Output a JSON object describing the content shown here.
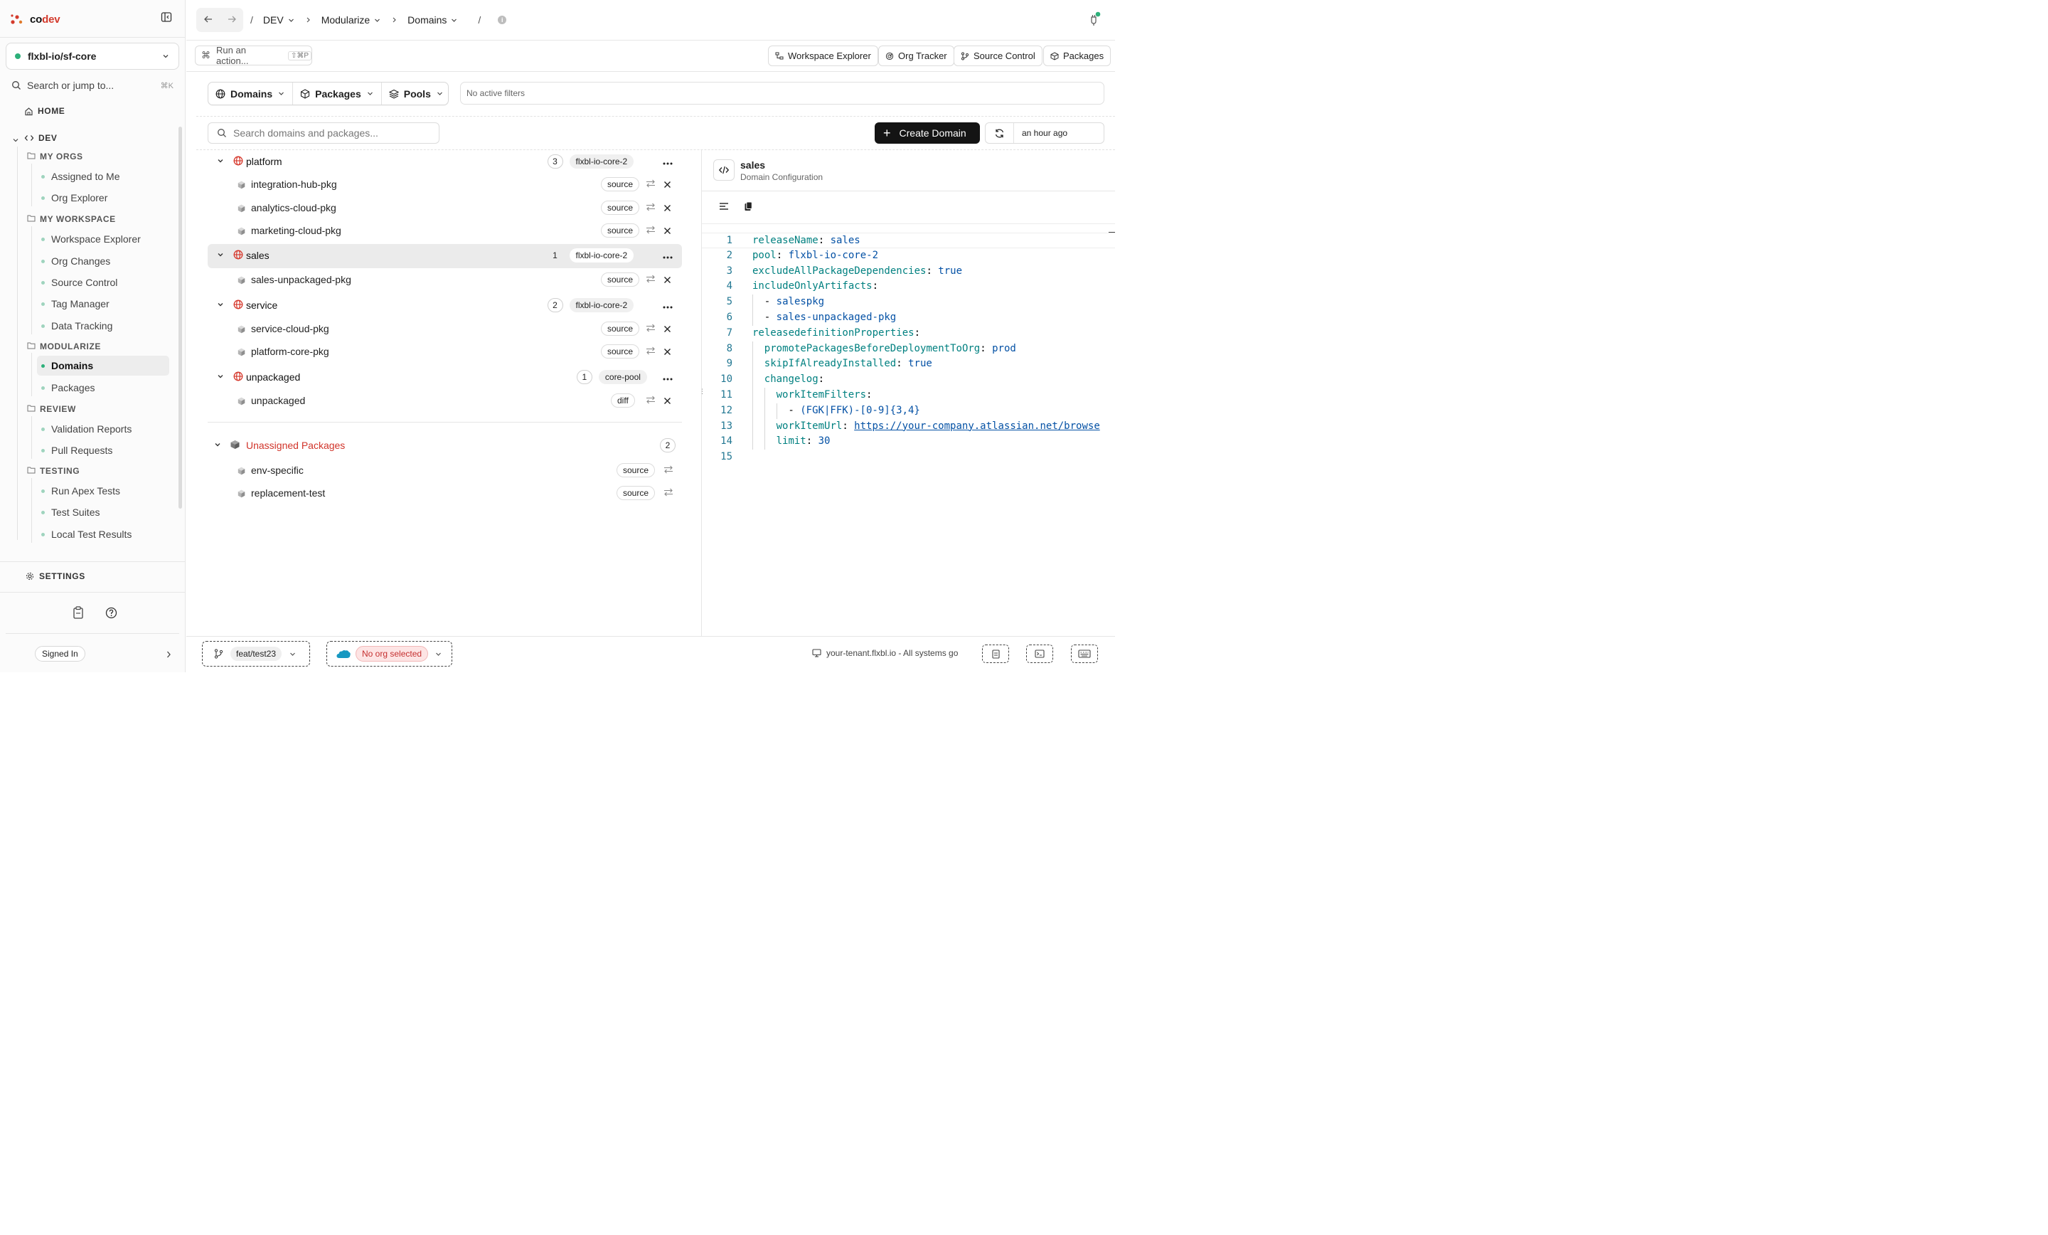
{
  "brand": {
    "name_a": "co",
    "name_b": "dev",
    "accent": "#d33a2c"
  },
  "sidebar": {
    "workspace": "flxbl-io/sf-core",
    "search_placeholder": "Search or jump to...",
    "search_kbd": "⌘K",
    "home": "HOME",
    "root": "DEV",
    "sections": [
      {
        "label": "MY ORGS",
        "items": [
          "Assigned to Me",
          "Org Explorer"
        ]
      },
      {
        "label": "MY WORKSPACE",
        "items": [
          "Workspace Explorer",
          "Org Changes",
          "Source Control",
          "Tag Manager",
          "Data Tracking"
        ]
      },
      {
        "label": "MODULARIZE",
        "items": [
          "Domains",
          "Packages"
        ]
      },
      {
        "label": "REVIEW",
        "items": [
          "Validation Reports",
          "Pull Requests"
        ]
      },
      {
        "label": "TESTING",
        "items": [
          "Run Apex Tests",
          "Test Suites",
          "Local Test Results"
        ]
      }
    ],
    "active_item": "Domains",
    "settings": "SETTINGS",
    "signed_in": "Signed In"
  },
  "topbar": {
    "breadcrumbs": [
      "DEV",
      "Modularize",
      "Domains"
    ],
    "action_placeholder": "Run an action...",
    "action_kbd": "⇧⌘P",
    "tools": [
      "Workspace Explorer",
      "Org Tracker",
      "Source Control",
      "Packages"
    ]
  },
  "filters": {
    "segments": [
      "Domains",
      "Packages",
      "Pools"
    ],
    "active_filters": "No active filters",
    "search_placeholder": "Search domains and packages...",
    "create_label": "Create Domain",
    "refreshed": "an hour ago"
  },
  "domains": [
    {
      "name": "platform",
      "count": "3",
      "pool": "flxbl-io-core-2",
      "packages": [
        {
          "name": "integration-hub-pkg",
          "type": "source"
        },
        {
          "name": "analytics-cloud-pkg",
          "type": "source"
        },
        {
          "name": "marketing-cloud-pkg",
          "type": "source"
        }
      ]
    },
    {
      "name": "sales",
      "count": "1",
      "pool": "flxbl-io-core-2",
      "packages": [
        {
          "name": "sales-unpackaged-pkg",
          "type": "source"
        }
      ]
    },
    {
      "name": "service",
      "count": "2",
      "pool": "flxbl-io-core-2",
      "packages": [
        {
          "name": "service-cloud-pkg",
          "type": "source"
        },
        {
          "name": "platform-core-pkg",
          "type": "source"
        }
      ]
    },
    {
      "name": "unpackaged",
      "count": "1",
      "pool": "core-pool",
      "packages": [
        {
          "name": "unpackaged",
          "type": "diff"
        }
      ]
    }
  ],
  "unassigned": {
    "label": "Unassigned Packages",
    "count": "2",
    "packages": [
      {
        "name": "env-specific",
        "type": "source"
      },
      {
        "name": "replacement-test",
        "type": "source"
      }
    ]
  },
  "config": {
    "title": "sales",
    "subtitle": "Domain Configuration",
    "lines": [
      {
        "n": "1",
        "indent": 0,
        "key": "releaseName",
        "val": "sales"
      },
      {
        "n": "2",
        "indent": 0,
        "key": "pool",
        "val": "flxbl-io-core-2"
      },
      {
        "n": "3",
        "indent": 0,
        "key": "excludeAllPackageDependencies",
        "val": "true"
      },
      {
        "n": "4",
        "indent": 0,
        "key": "includeOnlyArtifacts",
        "val": ""
      },
      {
        "n": "5",
        "indent": 1,
        "item": "salespkg"
      },
      {
        "n": "6",
        "indent": 1,
        "item": "sales-unpackaged-pkg"
      },
      {
        "n": "7",
        "indent": 0,
        "key": "releasedefinitionProperties",
        "val": ""
      },
      {
        "n": "8",
        "indent": 1,
        "key": "promotePackagesBeforeDeploymentToOrg",
        "val": "prod"
      },
      {
        "n": "9",
        "indent": 1,
        "key": "skipIfAlreadyInstalled",
        "val": "true"
      },
      {
        "n": "10",
        "indent": 1,
        "key": "changelog",
        "val": ""
      },
      {
        "n": "11",
        "indent": 2,
        "key": "workItemFilters",
        "val": ""
      },
      {
        "n": "12",
        "indent": 3,
        "item": "(FGK|FFK)-[0-9]{3,4}"
      },
      {
        "n": "13",
        "indent": 2,
        "key": "workItemUrl",
        "val": "https://your-company.atlassian.net/browse",
        "url": true
      },
      {
        "n": "14",
        "indent": 2,
        "key": "limit",
        "val": "30"
      },
      {
        "n": "15",
        "indent": 0
      }
    ]
  },
  "status": {
    "branch": "feat/test23",
    "org": "No org selected",
    "tenant": "your-tenant.flxbl.io - All systems go"
  }
}
